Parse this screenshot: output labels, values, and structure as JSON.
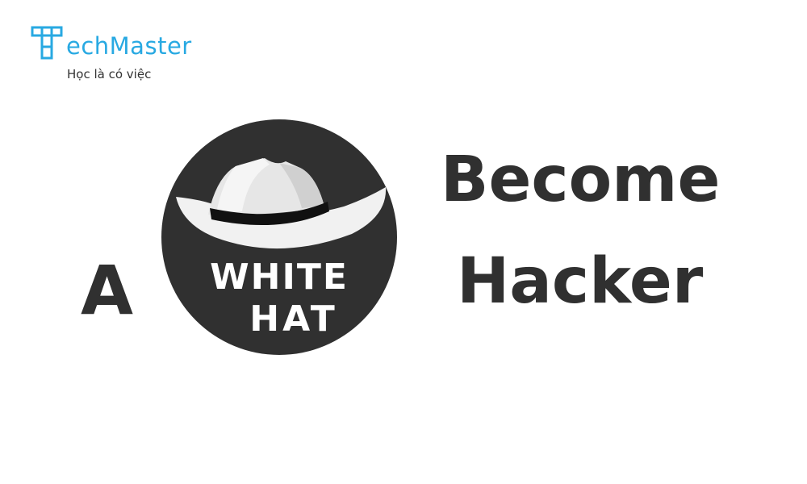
{
  "brand": {
    "name": "TechMaster",
    "name_suffix": "echMaster",
    "tagline": "Học là có việc",
    "logo_icon": "grid-t-icon",
    "color": "#28a9e2"
  },
  "headline": {
    "article": "A",
    "word1": "Become",
    "word2": "Hacker"
  },
  "emblem": {
    "icon": "white-hat-icon",
    "line1": "WHITE",
    "line2": "HAT",
    "circle_color": "#303030"
  }
}
